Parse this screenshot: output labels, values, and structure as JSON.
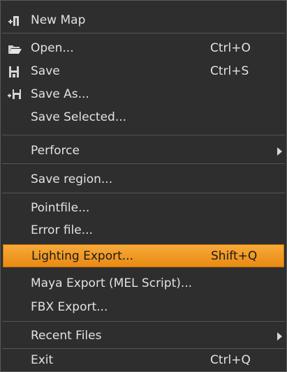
{
  "menu": {
    "items": [
      {
        "label": "New Map",
        "shortcut": "",
        "icon": "new-map-icon"
      },
      {
        "label": "Open...",
        "shortcut": "Ctrl+O",
        "icon": "folder-open-icon"
      },
      {
        "label": "Save",
        "shortcut": "Ctrl+S",
        "icon": "save-icon"
      },
      {
        "label": "Save As...",
        "shortcut": "",
        "icon": "save-as-icon"
      },
      {
        "label": "Save Selected...",
        "shortcut": ""
      },
      {
        "label": "Perforce",
        "shortcut": "",
        "submenu": true
      },
      {
        "label": "Save region...",
        "shortcut": ""
      },
      {
        "label": "Pointfile...",
        "shortcut": ""
      },
      {
        "label": "Error file...",
        "shortcut": ""
      },
      {
        "label": "Lighting Export...",
        "shortcut": "Shift+Q",
        "highlighted": true
      },
      {
        "label": "Maya Export (MEL Script)...",
        "shortcut": ""
      },
      {
        "label": "FBX Export...",
        "shortcut": ""
      },
      {
        "label": "Recent Files",
        "shortcut": "",
        "submenu": true
      },
      {
        "label": "Exit",
        "shortcut": "Ctrl+Q"
      }
    ]
  },
  "colors": {
    "menu_background": "#2e2e2e",
    "text": "#e2e2e2",
    "highlight_top": "#f7aa3a",
    "highlight_bottom": "#e98a12",
    "separator": "#555555"
  }
}
